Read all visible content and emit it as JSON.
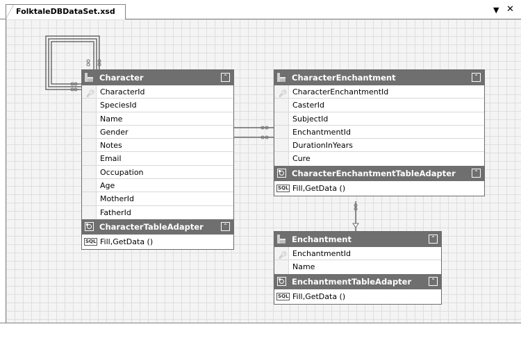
{
  "tab": {
    "title": "FolktaleDBDataSet.xsd",
    "dropdown_icon": "chevron-down-icon",
    "close_icon": "close-icon"
  },
  "tables": {
    "character": {
      "name": "Character",
      "columns": [
        "CharacterId",
        "SpeciesId",
        "Name",
        "Gender",
        "Notes",
        "Email",
        "Occupation",
        "Age",
        "MotherId",
        "FatherId"
      ],
      "adapter": "CharacterTableAdapter",
      "method": "Fill,GetData ()"
    },
    "character_enchantment": {
      "name": "CharacterEnchantment",
      "columns": [
        "CharacterEnchantmentId",
        "CasterId",
        "SubjectId",
        "EnchantmentId",
        "DurationInYears",
        "Cure"
      ],
      "adapter": "CharacterEnchantmentTableAdapter",
      "method": "Fill,GetData ()"
    },
    "enchantment": {
      "name": "Enchantment",
      "columns": [
        "EnchantmentId",
        "Name"
      ],
      "adapter": "EnchantmentTableAdapter",
      "method": "Fill,GetData ()"
    }
  },
  "sql_label": "SQL",
  "collapse_glyph": "⌃"
}
